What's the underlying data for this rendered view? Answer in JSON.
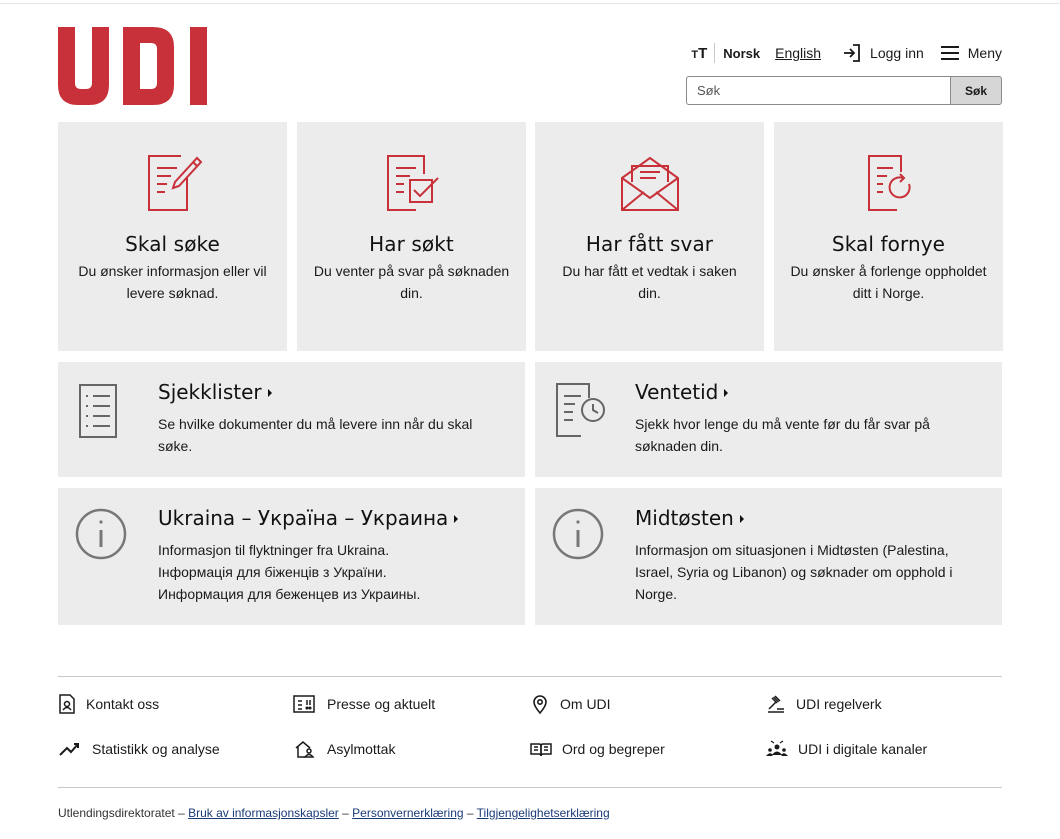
{
  "brand": {
    "logo_text": "UDI",
    "accent_color": "#c8313a"
  },
  "header": {
    "text_size_label": "TT",
    "lang_norsk": "Norsk",
    "lang_english": "English",
    "login_label": "Logg inn",
    "menu_label": "Meny"
  },
  "search": {
    "placeholder": "Søk",
    "button_label": "Søk"
  },
  "tiles": [
    {
      "title": "Skal søke",
      "text": "Du ønsker informasjon eller vil levere søknad.",
      "icon": "edit-document-icon"
    },
    {
      "title": "Har søkt",
      "text": "Du venter på svar på søknaden din.",
      "icon": "checked-document-icon"
    },
    {
      "title": "Har fått svar",
      "text": "Du har fått et vedtak i saken din.",
      "icon": "envelope-icon"
    },
    {
      "title": "Skal fornye",
      "text": "Du ønsker å forlenge oppholdet ditt i Norge.",
      "icon": "renew-document-icon"
    }
  ],
  "wide_tiles": [
    {
      "title": "Sjekklister",
      "text": "Se hvilke dokumenter du må levere inn når du skal søke.",
      "icon": "checklist-icon"
    },
    {
      "title": "Ventetid",
      "text": "Sjekk hvor lenge du må vente før du får svar på søknaden din.",
      "icon": "document-clock-icon"
    },
    {
      "title": "Ukraina – Україна – Украина",
      "lines": [
        "Informasjon til flyktninger fra Ukraina.",
        "Інформація для біженців з України.",
        "Информация для беженцев из Украины."
      ],
      "icon": "info-icon"
    },
    {
      "title": "Midtøsten",
      "text": "Informasjon om situasjonen i Midtøsten (Palestina, Israel, Syria og Libanon) og søknader om opphold i Norge.",
      "icon": "info-icon"
    }
  ],
  "footer_links": [
    {
      "label": "Kontakt oss",
      "icon": "contact-icon"
    },
    {
      "label": "Presse og aktuelt",
      "icon": "press-icon"
    },
    {
      "label": "Om UDI",
      "icon": "location-pin-icon"
    },
    {
      "label": "UDI regelverk",
      "icon": "gavel-icon"
    },
    {
      "label": "Statistikk og analyse",
      "icon": "trend-chart-icon"
    },
    {
      "label": "Asylmottak",
      "icon": "house-person-icon"
    },
    {
      "label": "Ord og begreper",
      "icon": "open-book-icon"
    },
    {
      "label": "UDI i digitale kanaler",
      "icon": "people-group-icon"
    }
  ],
  "legal": {
    "org": "Utlendingsdirektoratet",
    "sep": " – ",
    "cookies": "Bruk av informasjonskapsler",
    "privacy": "Personvernerklæring",
    "accessibility": "Tilgjengelighetserklæring"
  }
}
